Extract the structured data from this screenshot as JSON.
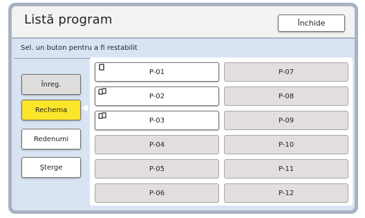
{
  "header": {
    "title": "Listă program",
    "close_label": "Închide"
  },
  "hint": "Sel. un buton pentru a fi restabilit",
  "side_buttons": [
    {
      "label": "Înreg.",
      "state": "gray"
    },
    {
      "label": "Rechema",
      "state": "active"
    },
    {
      "label": "Redenumi",
      "state": "white"
    },
    {
      "label": "Şterge",
      "state": "white"
    }
  ],
  "programs_left": [
    {
      "label": "P-01",
      "saved": true,
      "icon": "single-page-icon"
    },
    {
      "label": "P-02",
      "saved": true,
      "icon": "multi-page-icon"
    },
    {
      "label": "P-03",
      "saved": true,
      "icon": "multi-page-icon"
    },
    {
      "label": "P-04",
      "saved": false
    },
    {
      "label": "P-05",
      "saved": false
    },
    {
      "label": "P-06",
      "saved": false
    }
  ],
  "programs_right": [
    {
      "label": "P-07",
      "saved": false
    },
    {
      "label": "P-08",
      "saved": false
    },
    {
      "label": "P-09",
      "saved": false
    },
    {
      "label": "P-10",
      "saved": false
    },
    {
      "label": "P-11",
      "saved": false
    },
    {
      "label": "P-12",
      "saved": false
    }
  ],
  "colors": {
    "active": "#fce62a",
    "panel": "#d9e4f3",
    "frame": "#a7b2c2"
  }
}
